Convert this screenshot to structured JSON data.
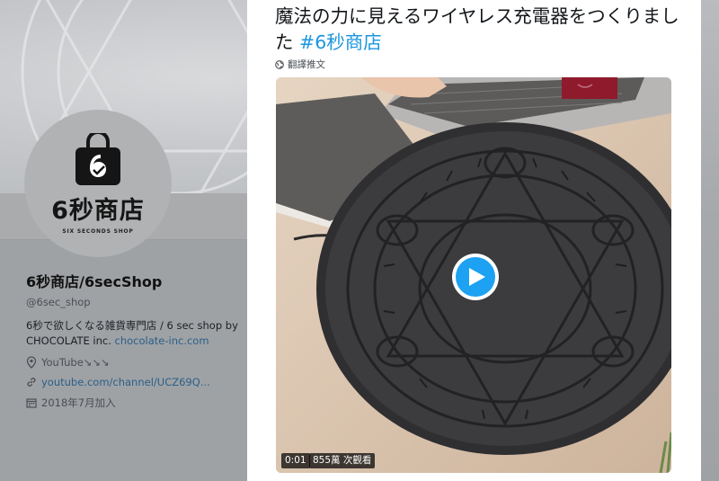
{
  "profile": {
    "logo_text": "6秒商店",
    "logo_subtext": "SIX SECONDS SHOP",
    "name": "6秒商店/6secShop",
    "handle": "@6sec_shop",
    "bio": "6秒で欲しくなる雑貨専門店 / 6 sec shop by CHOCOLATE inc. ",
    "bio_link": "chocolate-inc.com",
    "location": "YouTube↘↘↘",
    "url": "youtube.com/channel/UCZ69Q...",
    "joined": "2018年7月加入"
  },
  "tweet": {
    "text": "魔法の力に見えるワイヤレス充電器をつくりました ",
    "hashtag": "#6秒商店",
    "translate_label": "翻譯推文"
  },
  "video": {
    "time": "0:01",
    "views": "855萬 次觀看"
  },
  "colors": {
    "hashtag": "#1b95e0",
    "play_button": "#1da1f2",
    "link": "#2a5f8a"
  },
  "icons": {
    "location": "location-pin-icon",
    "link": "link-icon",
    "calendar": "calendar-icon",
    "globe": "globe-icon",
    "play": "play-icon"
  }
}
